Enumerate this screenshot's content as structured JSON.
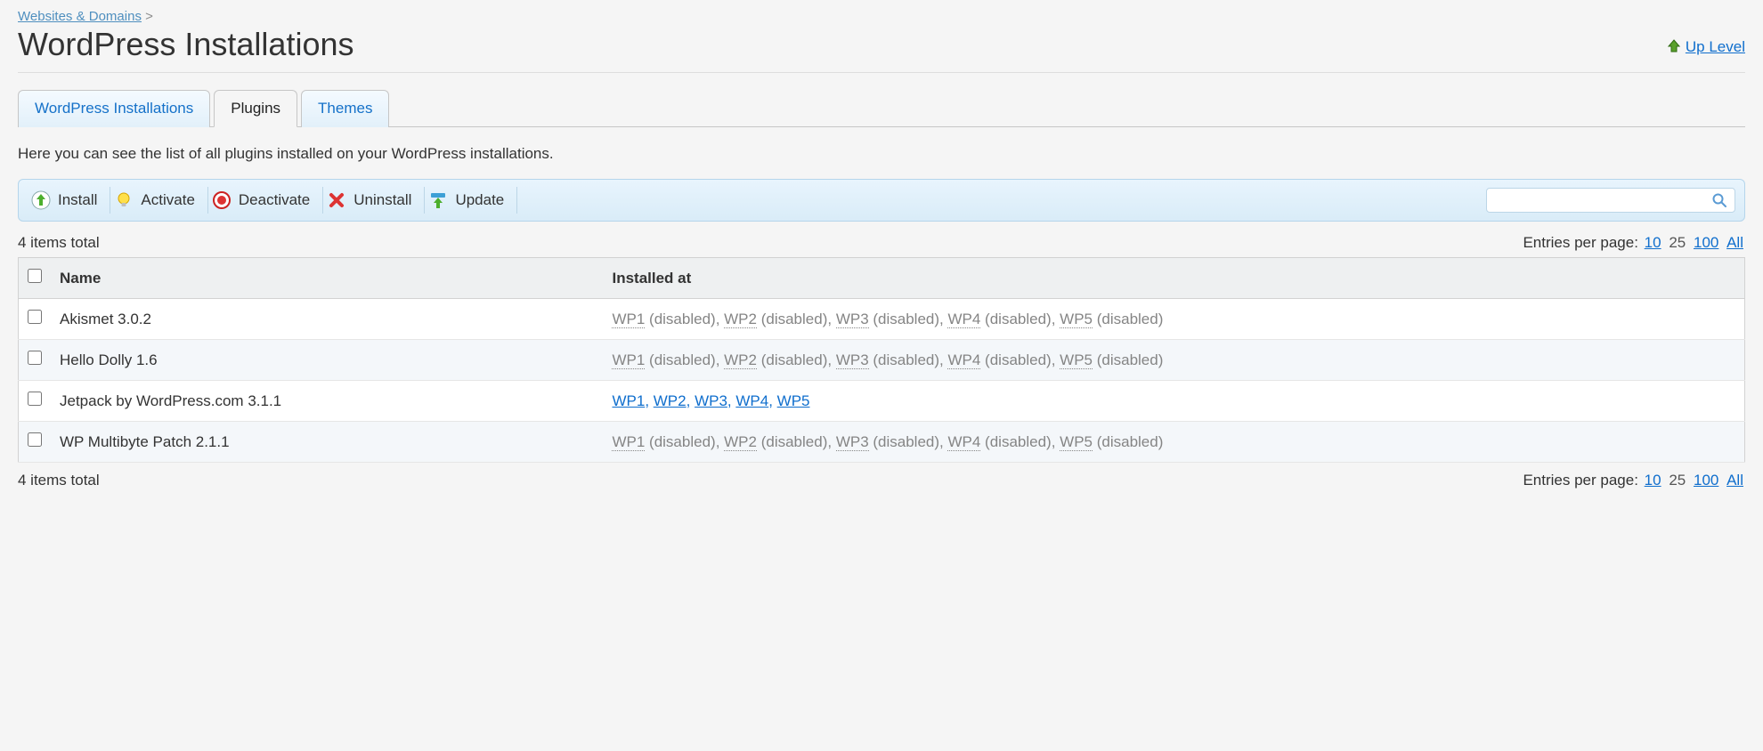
{
  "breadcrumb": {
    "link": "Websites & Domains",
    "sep": ">"
  },
  "page_title": "WordPress Installations",
  "up_level": "Up Level",
  "tabs": [
    {
      "label": "WordPress Installations",
      "active": false
    },
    {
      "label": "Plugins",
      "active": true
    },
    {
      "label": "Themes",
      "active": false
    }
  ],
  "description": "Here you can see the list of all plugins installed on your WordPress installations.",
  "toolbar": {
    "install": "Install",
    "activate": "Activate",
    "deactivate": "Deactivate",
    "uninstall": "Uninstall",
    "update": "Update",
    "search_placeholder": ""
  },
  "pager": {
    "total_label": "4 items total",
    "entries_label": "Entries per page:",
    "opt10": "10",
    "opt25": "25",
    "opt100": "100",
    "optAll": "All"
  },
  "table": {
    "headers": {
      "name": "Name",
      "installed_at": "Installed at"
    },
    "disabled_suffix": "(disabled)",
    "sites": [
      "WP1",
      "WP2",
      "WP3",
      "WP4",
      "WP5"
    ],
    "rows": [
      {
        "name": "Akismet 3.0.2",
        "state": "disabled"
      },
      {
        "name": "Hello Dolly 1.6",
        "state": "disabled"
      },
      {
        "name": "Jetpack by WordPress.com 3.1.1",
        "state": "enabled"
      },
      {
        "name": "WP Multibyte Patch 2.1.1",
        "state": "disabled"
      }
    ]
  }
}
